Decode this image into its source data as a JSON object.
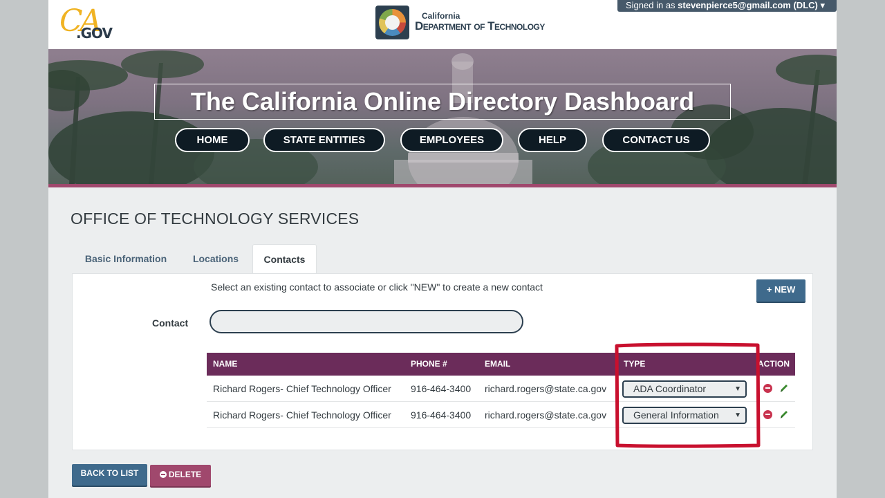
{
  "header": {
    "ca_logo_text": "CA",
    "gov_text": ".GOV",
    "dept_small": "California",
    "dept_name": "Department of Technology",
    "signed_in_prefix": "Signed in as ",
    "signed_in_user": "stevenpierce5@gmail.com (DLC)"
  },
  "hero": {
    "title": "The California Online Directory Dashboard",
    "nav": [
      "HOME",
      "STATE ENTITIES",
      "EMPLOYEES",
      "HELP",
      "CONTACT US"
    ]
  },
  "org": {
    "title": "OFFICE OF TECHNOLOGY SERVICES"
  },
  "tabs": [
    "Basic Information",
    "Locations",
    "Contacts"
  ],
  "active_tab": "Contacts",
  "contacts_panel": {
    "instructions": "Select an existing contact to associate or click \"NEW\" to create a new contact",
    "new_label": "NEW",
    "contact_label": "Contact",
    "contact_value": "",
    "columns": [
      "NAME",
      "PHONE #",
      "EMAIL",
      "TYPE",
      "ACTION"
    ],
    "rows": [
      {
        "name": "Richard Rogers- Chief Technology Officer",
        "phone": "916-464-3400",
        "email": "richard.rogers@state.ca.gov",
        "type": "ADA Coordinator"
      },
      {
        "name": "Richard Rogers- Chief Technology Officer",
        "phone": "916-464-3400",
        "email": "richard.rogers@state.ca.gov",
        "type": "General Information"
      }
    ]
  },
  "footer_buttons": {
    "back": "BACK TO LIST",
    "delete": "DELETE"
  },
  "colors": {
    "accent": "#6b2c5a",
    "primary": "#3f6a8c",
    "danger": "#a0486d",
    "highlight": "#c8102e"
  },
  "icons": [
    "plus-icon",
    "remove-icon",
    "edit-pencil-icon",
    "minus-circle-icon",
    "caret-down-icon"
  ]
}
